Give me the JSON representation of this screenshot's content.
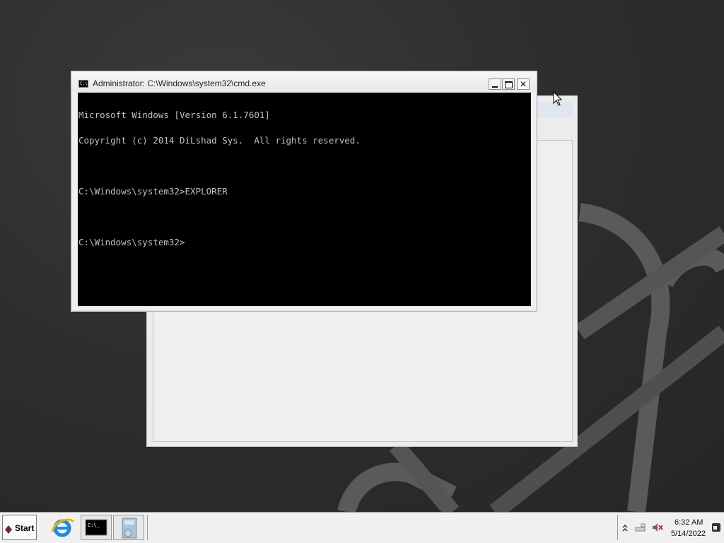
{
  "cmd_window": {
    "title": "Administrator: C:\\Windows\\system32\\cmd.exe",
    "console_lines": [
      "Microsoft Windows [Version 6.1.7601]",
      "Copyright (c) 2014 DiLshad Sys.  All rights reserved.",
      "",
      "C:\\Windows\\system32>EXPLORER",
      "",
      "C:\\Windows\\system32>"
    ],
    "icon_text": "C:\\"
  },
  "taskbar": {
    "start_label": "Start",
    "cmd_icon_text": "C:\\_",
    "clock_time": "6:32 AM",
    "clock_date": "5/14/2022"
  },
  "icons": {
    "start": "start-gem-icon",
    "ie": "internet-explorer-icon",
    "cmd": "command-prompt-icon",
    "explorer": "windows-explorer-icon",
    "tray_expand": "chevron-up-icon",
    "network": "network-icon",
    "volume": "volume-muted-icon",
    "show_desktop": "show-desktop-icon"
  },
  "colors": {
    "console_bg": "#000000",
    "console_fg": "#c0c0c0",
    "desktop": "#2c2c2c",
    "taskbar": "#f0f0f0"
  }
}
